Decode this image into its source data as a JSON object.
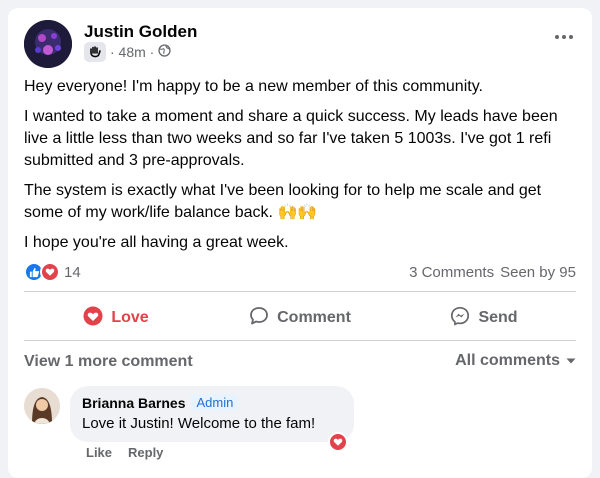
{
  "post": {
    "author": "Justin Golden",
    "time": "· 48m ·",
    "audience_icon": "globe-icon",
    "badge_icon": "wave-hand-icon",
    "paragraphs": [
      "Hey everyone! I'm happy to be a new member of this community.",
      "I wanted to take a moment and share a quick success. My leads have been live a little less than two weeks and so far I've taken 5 1003s.  I've got 1 refi submitted and 3 pre-approvals.",
      "The system is exactly what I've been looking for to help me scale and get some of my work/life balance back. 🙌🙌",
      "I hope you're all having a great week."
    ]
  },
  "stats": {
    "reactions_count": "14",
    "reaction_icons": [
      "like-icon",
      "love-icon"
    ],
    "comments": "3 Comments",
    "seen": "Seen by 95"
  },
  "actions": {
    "love": "Love",
    "comment": "Comment",
    "send": "Send"
  },
  "comments_section": {
    "view_more": "View 1 more comment",
    "sort_label": "All comments",
    "comment": {
      "name": "Brianna Barnes",
      "badge": "Admin",
      "text": "Love it Justin! Welcome to the fam!",
      "like": "Like",
      "reply": "Reply"
    }
  },
  "colors": {
    "love_red": "#e2424a",
    "like_blue": "#1877f2",
    "muted": "#65676b",
    "admin_blue": "#216fdb"
  }
}
